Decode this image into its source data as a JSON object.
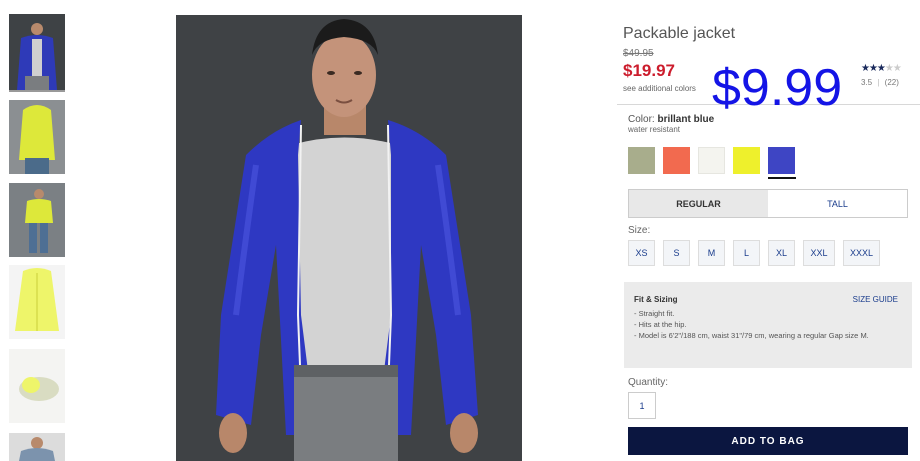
{
  "product": {
    "title": "Packable jacket",
    "original_price": "$49.95",
    "sale_price": "$19.97",
    "additional_colors": "see additional colors",
    "overlay_price": "$9.99",
    "rating": {
      "stars_filled": 3.5,
      "stars_total": 5,
      "value": "3.5",
      "separator": "|",
      "count": "(22)"
    }
  },
  "thumbnails": [
    {
      "name": "thumb-blue-jacket-front",
      "color": "#2e3ab8",
      "active": true
    },
    {
      "name": "thumb-yellow-jacket-model",
      "color": "#dde83a",
      "active": false
    },
    {
      "name": "thumb-yellow-jacket-full",
      "color": "#c8d640",
      "active": false
    },
    {
      "name": "thumb-yellow-jacket-flat",
      "color": "#eef56a",
      "active": false
    },
    {
      "name": "thumb-packed-pouch",
      "color": "#e9eccf",
      "active": false
    },
    {
      "name": "thumb-model-partial",
      "color": "#b7c2cf",
      "active": false
    }
  ],
  "color": {
    "label": "Color:",
    "selected": "brillant blue",
    "feature": "water resistant",
    "swatches": [
      {
        "name": "swatch-khaki",
        "hex": "#a8ad8c"
      },
      {
        "name": "swatch-coral",
        "hex": "#f26a4f"
      },
      {
        "name": "swatch-white",
        "hex": "#f4f4ef"
      },
      {
        "name": "swatch-yellow",
        "hex": "#eef02c"
      },
      {
        "name": "swatch-brilliant-blue",
        "hex": "#3e45c4"
      }
    ]
  },
  "fit_tabs": [
    "REGULAR",
    "TALL"
  ],
  "size": {
    "label": "Size:",
    "options": [
      "XS",
      "S",
      "M",
      "L",
      "XL",
      "XXL",
      "XXXL"
    ]
  },
  "fit_sizing": {
    "title": "Fit & Sizing",
    "guide_link": "SIZE GUIDE",
    "bullets": [
      "- Straight fit.",
      "- Hits at the hip.",
      "- Model is 6'2\"/188 cm, waist 31\"/79 cm, wearing a regular Gap size M."
    ]
  },
  "quantity": {
    "label": "Quantity:",
    "value": "1"
  },
  "add_to_bag": "ADD TO BAG",
  "colors": {
    "sale_red": "#cc1d2d",
    "overlay_blue": "#1414e6",
    "button_navy": "#0b1640",
    "link_blue": "#1a3c8c",
    "photo_bg": "#3f4245",
    "jacket_blue": "#2e38c2"
  }
}
